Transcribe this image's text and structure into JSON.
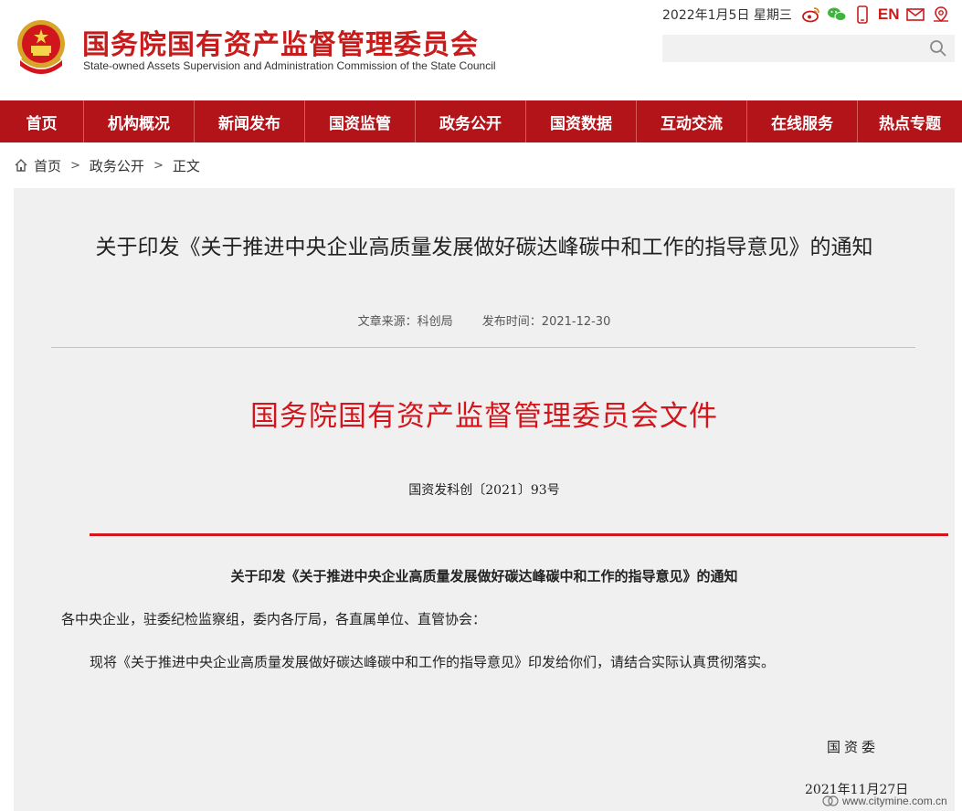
{
  "header": {
    "site_title": "国务院国有资产监督管理委员会",
    "site_subtitle": "State-owned Assets Supervision and Administration Commission of the State Council",
    "date_text": "2022年1月5日 星期三",
    "english_label": "EN",
    "search_placeholder": ""
  },
  "nav": {
    "items": [
      "首页",
      "机构概况",
      "新闻发布",
      "国资监管",
      "政务公开",
      "国资数据",
      "互动交流",
      "在线服务",
      "热点专题"
    ]
  },
  "breadcrumb": {
    "home": "首页",
    "sep": ">",
    "section": "政务公开",
    "current": "正文"
  },
  "article": {
    "title": "关于印发《关于推进中央企业高质量发展做好碳达峰碳中和工作的指导意见》的通知",
    "source_label": "文章来源：科创局",
    "publish_label": "发布时间：2021-12-30",
    "doc_head": "国务院国有资产监督管理委员会文件",
    "doc_number": "国资发科创〔2021〕93号",
    "notice_title": "关于印发《关于推进中央企业高质量发展做好碳达峰碳中和工作的指导意见》的通知",
    "salutation": "各中央企业，驻委纪检监察组，委内各厅局，各直属单位、直管协会：",
    "body": "现将《关于推进中央企业高质量发展做好碳达峰碳中和工作的指导意见》印发给你们，请结合实际认真贯彻落实。",
    "signer": "国资委",
    "sign_date": "2021年11月27日"
  },
  "watermark": {
    "text": "www.citymine.com.cn"
  },
  "colors": {
    "brand_red": "#c81c1c",
    "nav_red": "#b3141a",
    "doc_red": "#d2161c"
  }
}
